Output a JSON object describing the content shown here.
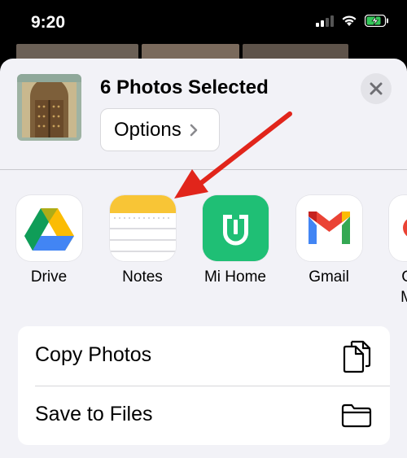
{
  "status_bar": {
    "time": "9:20"
  },
  "share_sheet": {
    "title": "6 Photos Selected",
    "options_label": "Options",
    "apps": [
      {
        "label": "Drive",
        "icon": "google-drive-icon"
      },
      {
        "label": "Notes",
        "icon": "notes-icon"
      },
      {
        "label": "Mi Home",
        "icon": "mi-home-icon"
      },
      {
        "label": "Gmail",
        "icon": "gmail-icon"
      },
      {
        "label": "G",
        "label_line2": "M",
        "icon": "partial-app-icon"
      }
    ],
    "actions": [
      {
        "label": "Copy Photos",
        "icon": "copy-photos-icon"
      },
      {
        "label": "Save to Files",
        "icon": "folder-icon"
      }
    ]
  },
  "colors": {
    "mi_home_green": "#1fbf75",
    "annotation_red": "#e1251b",
    "notes_yellow": "#f8c536"
  }
}
